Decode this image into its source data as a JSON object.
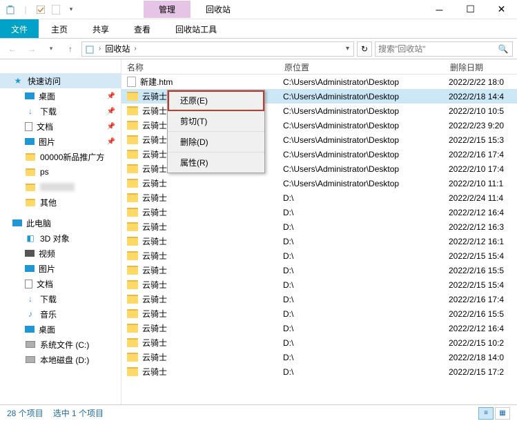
{
  "title_tabs": {
    "manage": "管理",
    "recycle": "回收站"
  },
  "ribbon": {
    "file": "文件",
    "home": "主页",
    "share": "共享",
    "view": "查看",
    "tools": "回收站工具"
  },
  "breadcrumb": {
    "root": "回收站"
  },
  "search": {
    "placeholder": "搜索\"回收站\""
  },
  "tree": {
    "quick": "快速访问",
    "desktop": "桌面",
    "downloads": "下载",
    "documents": "文档",
    "pictures": "图片",
    "promo": "00000新品推广方",
    "ps": "ps",
    "blurred": "          ",
    "other": "其他",
    "thispc": "此电脑",
    "objects3d": "3D 对象",
    "video": "视频",
    "pictures2": "图片",
    "documents2": "文档",
    "downloads2": "下载",
    "music": "音乐",
    "desktop2": "桌面",
    "sysdisk": "系统文件 (C:)",
    "localdisk": "本地磁盘 (D:)"
  },
  "columns": {
    "name": "名称",
    "loc": "原位置",
    "date": "删除日期"
  },
  "ctx": {
    "restore": "还原(E)",
    "cut": "剪切(T)",
    "delete": "删除(D)",
    "props": "属性(R)"
  },
  "rows": [
    {
      "name": "新建.htm",
      "loc": "C:\\Users\\Administrator\\Desktop",
      "date": "2022/2/22 18:0",
      "type": "file"
    },
    {
      "name": "云骑士",
      "loc": "C:\\Users\\Administrator\\Desktop",
      "date": "2022/2/18 14:4",
      "sel": true
    },
    {
      "name": "云骑士",
      "loc": "C:\\Users\\Administrator\\Desktop",
      "date": "2022/2/10 10:5"
    },
    {
      "name": "云骑士",
      "loc": "C:\\Users\\Administrator\\Desktop",
      "date": "2022/2/23 9:20"
    },
    {
      "name": "云骑士",
      "loc": "C:\\Users\\Administrator\\Desktop",
      "date": "2022/2/15 15:3"
    },
    {
      "name": "云骑士",
      "loc": "C:\\Users\\Administrator\\Desktop",
      "date": "2022/2/16 17:4"
    },
    {
      "name": "云骑士",
      "loc": "C:\\Users\\Administrator\\Desktop",
      "date": "2022/2/10 17:4"
    },
    {
      "name": "云骑士",
      "loc": "C:\\Users\\Administrator\\Desktop",
      "date": "2022/2/10 11:1"
    },
    {
      "name": "云骑士",
      "loc": "D:\\",
      "date": "2022/2/24 11:4"
    },
    {
      "name": "云骑士",
      "loc": "D:\\",
      "date": "2022/2/12 16:4"
    },
    {
      "name": "云骑士",
      "loc": "D:\\",
      "date": "2022/2/12 16:3"
    },
    {
      "name": "云骑士",
      "loc": "D:\\",
      "date": "2022/2/12 16:1"
    },
    {
      "name": "云骑士",
      "loc": "D:\\",
      "date": "2022/2/15 15:4"
    },
    {
      "name": "云骑士",
      "loc": "D:\\",
      "date": "2022/2/16 15:5"
    },
    {
      "name": "云骑士",
      "loc": "D:\\",
      "date": "2022/2/15 15:4"
    },
    {
      "name": "云骑士",
      "loc": "D:\\",
      "date": "2022/2/16 17:4"
    },
    {
      "name": "云骑士",
      "loc": "D:\\",
      "date": "2022/2/16 15:5"
    },
    {
      "name": "云骑士",
      "loc": "D:\\",
      "date": "2022/2/12 16:4"
    },
    {
      "name": "云骑士",
      "loc": "D:\\",
      "date": "2022/2/15 10:2"
    },
    {
      "name": "云骑士",
      "loc": "D:\\",
      "date": "2022/2/18 14:0"
    },
    {
      "name": "云骑士",
      "loc": "D:\\",
      "date": "2022/2/15 17:2"
    }
  ],
  "status": {
    "count": "28 个项目",
    "selected": "选中 1 个项目"
  }
}
